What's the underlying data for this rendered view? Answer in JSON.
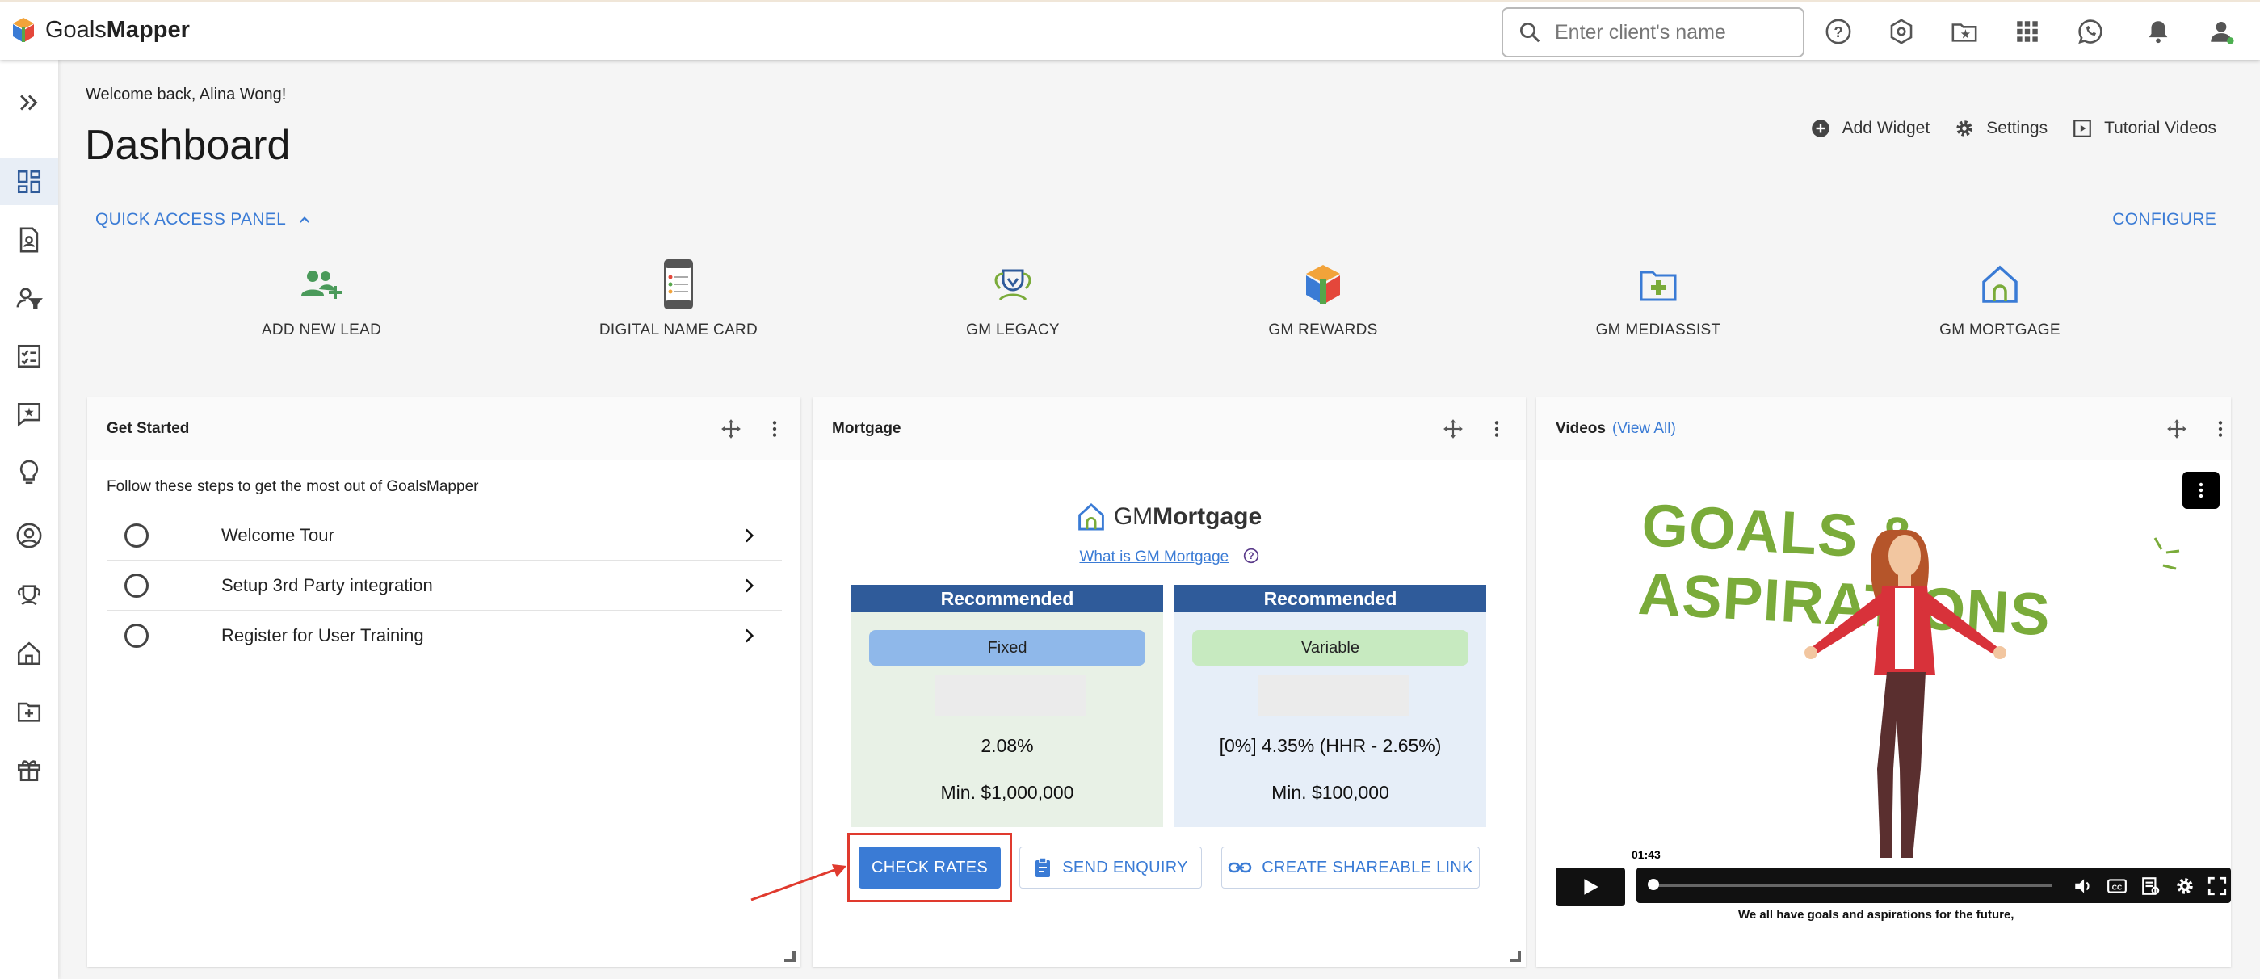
{
  "app": {
    "logo_text_light": "Goals",
    "logo_text_bold": "Mapper"
  },
  "topbar": {
    "search_placeholder": "Enter client's name",
    "icons": [
      "help-icon",
      "settings-gear-icon",
      "folder-star-icon",
      "apps-grid-icon",
      "whatsapp-icon",
      "bell-icon",
      "account-icon"
    ]
  },
  "sidebar": {
    "items": [
      "expand-icon",
      "dashboard-icon",
      "clients-icon",
      "lead-filter-icon",
      "tasks-icon",
      "feedback-icon",
      "ideas-icon",
      "profile-icon",
      "legacy-icon",
      "mortgage-icon",
      "mediassist-icon",
      "rewards-gift-icon"
    ],
    "active": "dashboard-icon"
  },
  "header": {
    "welcome": "Welcome back, Alina Wong!",
    "title": "Dashboard",
    "add_widget": "Add Widget",
    "settings": "Settings",
    "tutorial_videos": "Tutorial Videos"
  },
  "quick_access": {
    "label": "QUICK ACCESS PANEL",
    "configure": "CONFIGURE",
    "items": [
      {
        "label": "ADD NEW LEAD",
        "icon": "add-lead-icon"
      },
      {
        "label": "DIGITAL NAME CARD",
        "icon": "name-card-icon"
      },
      {
        "label": "GM LEGACY",
        "icon": "gm-legacy-icon"
      },
      {
        "label": "GM REWARDS",
        "icon": "gm-rewards-icon"
      },
      {
        "label": "GM MEDIASSIST",
        "icon": "gm-mediassist-icon"
      },
      {
        "label": "GM MORTGAGE",
        "icon": "gm-mortgage-icon"
      }
    ]
  },
  "get_started": {
    "title": "Get Started",
    "intro": "Follow these steps to get the most out of GoalsMapper",
    "steps": [
      "Welcome Tour",
      "Setup 3rd Party integration",
      "Register for User Training"
    ]
  },
  "mortgage": {
    "title": "Mortgage",
    "logo_light": "GM",
    "logo_bold": "Mortgage",
    "what_is": "What is GM Mortgage",
    "columns": [
      {
        "header": "Recommended",
        "type": "Fixed",
        "rate": "2.08%",
        "min": "Min. $1,000,000",
        "pill_color": "#8fb8ea",
        "bg": "#e8f1e6"
      },
      {
        "header": "Recommended",
        "type": "Variable",
        "rate": "[0%] 4.35% (HHR - 2.65%)",
        "min": "Min. $100,000",
        "pill_color": "#c7eac0",
        "bg": "#e6eef8"
      }
    ],
    "check_rates": "CHECK RATES",
    "send_enquiry": "SEND ENQUIRY",
    "create_link": "CREATE SHAREABLE LINK"
  },
  "videos": {
    "title": "Videos",
    "view_all": "(View All)",
    "video_title": "GOALS & ASPIRATIONS",
    "time": "01:43",
    "caption": "We all have goals and aspirations for the future,"
  },
  "colors": {
    "accent": "#3a7bd5",
    "header_blue": "#2f5b9a",
    "highlight_red": "#e03a2e",
    "video_green": "#7aab3a"
  }
}
